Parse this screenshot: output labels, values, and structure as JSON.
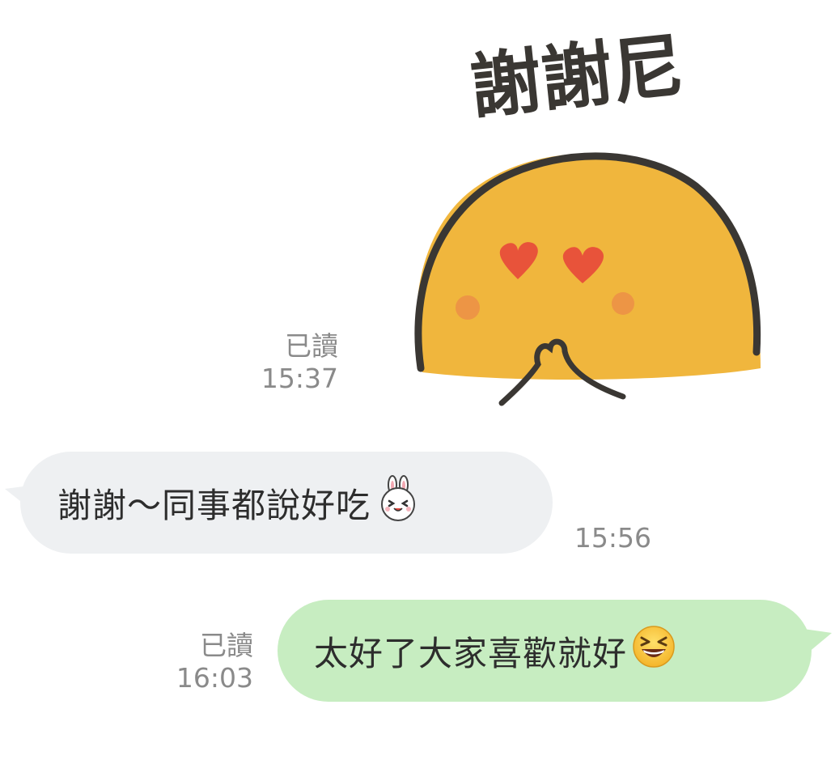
{
  "sticker": {
    "caption": "謝謝尼"
  },
  "messages": [
    {
      "direction": "outgoing",
      "type": "sticker",
      "read_label": "已讀",
      "time": "15:37"
    },
    {
      "direction": "incoming",
      "type": "text",
      "text": "謝謝～同事都說好吃",
      "emoji": "cony-laughing-icon",
      "time": "15:56"
    },
    {
      "direction": "outgoing",
      "type": "text",
      "text": "太好了大家喜歡就好",
      "emoji": "grinning-squint-icon",
      "read_label": "已讀",
      "time": "16:03"
    }
  ],
  "colors": {
    "incoming_bubble": "#eef0f2",
    "outgoing_bubble": "#c7edc1",
    "meta_text": "#8a8a8a",
    "sticker_body": "#f0b63d",
    "heart": "#e8533a"
  }
}
